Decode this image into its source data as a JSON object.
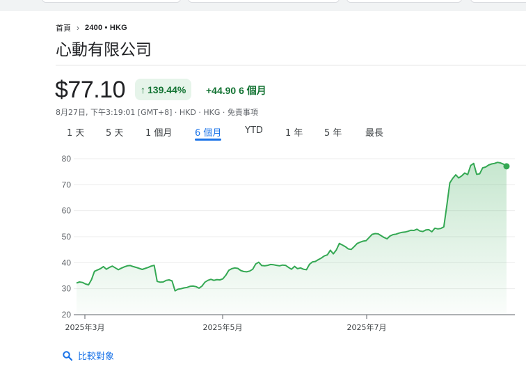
{
  "breadcrumb": {
    "home": "首頁",
    "ticker": "2400 • HKG"
  },
  "title": "心動有限公司",
  "quote": {
    "price": "$77.10",
    "change_percent": "139.44%",
    "change_abs": "+44.90 6 個月",
    "meta": "8月27日, 下午3:19:01 [GMT+8] · HKD · HKG · 免責事項"
  },
  "tabs": [
    "1 天",
    "5 天",
    "1 個月",
    "6 個月",
    "YTD",
    "1 年",
    "5 年",
    "最長"
  ],
  "active_tab": "6 個月",
  "compare_label": "比較對象",
  "colors": {
    "up": "#137333",
    "line": "#34a853",
    "accent": "#1a73e8"
  },
  "chart_data": {
    "type": "area",
    "ylim": [
      20,
      80
    ],
    "yticks": [
      20,
      30,
      40,
      50,
      60,
      70,
      80
    ],
    "xticks": [
      "2025年3月",
      "2025年5月",
      "2025年7月"
    ],
    "grid": true,
    "series": [
      {
        "values": [
          32.2,
          32.6,
          32.4,
          31.8,
          31.5,
          33.5,
          36.7,
          37.2,
          37.7,
          38.5,
          37.5,
          38.2,
          38.7,
          38.0,
          37.3,
          37.9,
          38.4,
          38.8,
          38.9,
          38.5,
          38.2,
          37.8,
          37.4,
          37.8,
          38.2,
          38.7,
          39.0,
          32.8,
          32.5,
          32.6,
          33.2,
          33.4,
          33.0,
          29.2,
          29.8,
          30.0,
          30.3,
          30.5,
          30.9,
          31.0,
          30.8,
          30.2,
          31.0,
          32.5,
          33.2,
          33.6,
          33.2,
          33.5,
          33.4,
          33.8,
          35.2,
          37.1,
          37.7,
          38.0,
          37.8,
          37.0,
          36.6,
          36.5,
          36.8,
          37.5,
          39.5,
          40.2,
          38.9,
          38.8,
          39.0,
          39.3,
          39.2,
          39.0,
          38.8,
          39.1,
          39.0,
          38.2,
          37.5,
          38.6,
          37.7,
          38.0,
          37.5,
          37.3,
          39.4,
          40.3,
          40.5,
          41.2,
          41.8,
          42.6,
          43.0,
          44.8,
          43.4,
          44.9,
          47.4,
          46.8,
          46.2,
          45.3,
          45.1,
          46.2,
          47.4,
          47.9,
          48.3,
          48.5,
          49.7,
          50.9,
          51.2,
          51.1,
          50.4,
          49.7,
          49.2,
          50.3,
          50.8,
          51.0,
          51.4,
          51.7,
          51.8,
          52.1,
          52.5,
          52.4,
          52.9,
          52.2,
          52.0,
          52.6,
          52.7,
          51.9,
          53.3,
          53.0,
          53.2,
          53.8,
          62.0,
          70.7,
          72.5,
          73.8,
          72.6,
          73.4,
          74.5,
          73.9,
          77.4,
          78.2,
          74.0,
          74.2,
          76.5,
          76.8,
          77.6,
          78.0,
          78.2,
          78.6,
          78.4,
          77.9,
          77.1
        ]
      }
    ]
  }
}
